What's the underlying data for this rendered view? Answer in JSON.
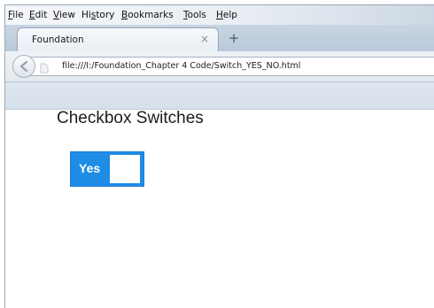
{
  "menu": {
    "items": [
      {
        "first": "F",
        "rest": "ile"
      },
      {
        "first": "E",
        "rest": "dit"
      },
      {
        "first": "V",
        "rest": "iew"
      },
      {
        "pre": "Hi",
        "first": "s",
        "rest": "tory"
      },
      {
        "first": "B",
        "rest": "ookmarks"
      },
      {
        "first": "T",
        "rest": "ools"
      },
      {
        "first": "H",
        "rest": "elp"
      }
    ]
  },
  "tab": {
    "title": "Foundation",
    "close_glyph": "×",
    "new_tab_glyph": "+"
  },
  "nav": {
    "url": "file:///I:/Foundation_Chapter 4 Code/Switch_YES_NO.html"
  },
  "page": {
    "heading": "Checkbox Switches",
    "switch_label": "Yes",
    "switch_on": true
  },
  "colors": {
    "switch_blue": "#1f8ce6"
  }
}
